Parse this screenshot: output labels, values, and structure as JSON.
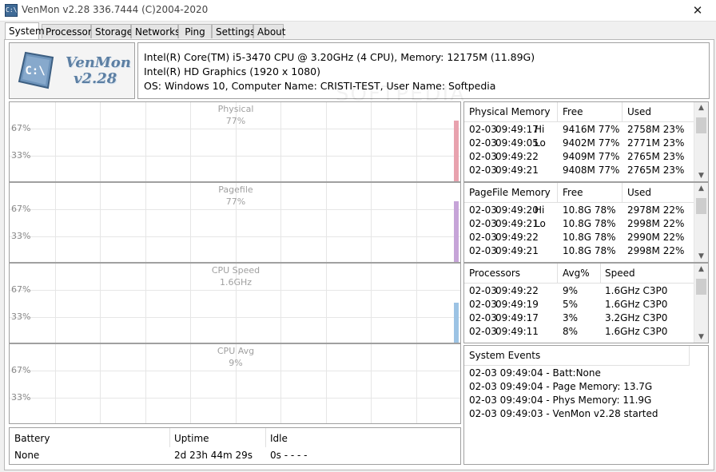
{
  "window": {
    "title": "VenMon v2.28 336.7444 (C)2004-2020",
    "close_symbol": "✕"
  },
  "tabs": [
    {
      "label": "System",
      "active": true
    },
    {
      "label": "Processors"
    },
    {
      "label": "Storage"
    },
    {
      "label": "Networks"
    },
    {
      "label": "Ping"
    },
    {
      "label": "Settings"
    },
    {
      "label": "About"
    }
  ],
  "logo": {
    "glyph": "C:\\",
    "name": "VenMon",
    "version": "v2.28"
  },
  "sysinfo": {
    "line1": "Intel(R) Core(TM) i5-3470 CPU @ 3.20GHz (4 CPU), Memory: 12175M (11.89G)",
    "line2": "Intel(R) HD Graphics (1920 x 1080)",
    "line3": "OS: Windows 10, Computer Name: CRISTI-TEST, User Name: Softpedia"
  },
  "graphs": [
    {
      "title": "Physical",
      "value": "77%",
      "tick_high": "67%",
      "tick_low": "33%",
      "level": 0.77,
      "color": "#e8a2ae"
    },
    {
      "title": "Pagefile",
      "value": "77%",
      "tick_high": "67%",
      "tick_low": "33%",
      "level": 0.77,
      "color": "#c6a4d8"
    },
    {
      "title": "CPU Speed",
      "value": "1.6GHz",
      "tick_high": "67%",
      "tick_low": "33%",
      "level": 0.5,
      "color": "#9cc3e4"
    },
    {
      "title": "CPU Avg",
      "value": "9%",
      "tick_high": "67%",
      "tick_low": "33%",
      "level": 0.0,
      "color": "#9ad2a6"
    }
  ],
  "physical_memory": {
    "headers": [
      "Physical Memory",
      "Free",
      "Used"
    ],
    "rows": [
      {
        "date": "02-03",
        "time": "09:49:17",
        "tag": "Hi",
        "free": "9416M 77%",
        "used": "2758M 23%"
      },
      {
        "date": "02-03",
        "time": "09:49:05",
        "tag": "Lo",
        "free": "9402M 77%",
        "used": "2771M 23%"
      },
      {
        "date": "02-03",
        "time": "09:49:22",
        "tag": "",
        "free": "9409M 77%",
        "used": "2765M 23%"
      },
      {
        "date": "02-03",
        "time": "09:49:21",
        "tag": "",
        "free": "9408M 77%",
        "used": "2765M 23%"
      }
    ]
  },
  "pagefile_memory": {
    "headers": [
      "PageFile Memory",
      "Free",
      "Used"
    ],
    "rows": [
      {
        "date": "02-03",
        "time": "09:49:20",
        "tag": "Hi",
        "free": "10.8G 78%",
        "used": "2978M 22%"
      },
      {
        "date": "02-03",
        "time": "09:49:21",
        "tag": "Lo",
        "free": "10.8G 78%",
        "used": "2998M 22%"
      },
      {
        "date": "02-03",
        "time": "09:49:22",
        "tag": "",
        "free": "10.8G 78%",
        "used": "2990M 22%"
      },
      {
        "date": "02-03",
        "time": "09:49:21",
        "tag": "",
        "free": "10.8G 78%",
        "used": "2998M 22%"
      }
    ]
  },
  "processors": {
    "headers": [
      "Processors",
      "Avg%",
      "Speed"
    ],
    "rows": [
      {
        "date": "02-03",
        "time": "09:49:22",
        "tag": "",
        "free": "9%",
        "used": "1.6GHz C3P0"
      },
      {
        "date": "02-03",
        "time": "09:49:19",
        "tag": "",
        "free": "5%",
        "used": "1.6GHz C3P0"
      },
      {
        "date": "02-03",
        "time": "09:49:17",
        "tag": "",
        "free": "3%",
        "used": "3.2GHz C3P0"
      },
      {
        "date": "02-03",
        "time": "09:49:11",
        "tag": "",
        "free": "8%",
        "used": "1.6GHz C3P0"
      }
    ]
  },
  "system_events": {
    "header": "System Events",
    "rows": [
      "02-03  09:49:04 - Batt:None",
      "02-03  09:49:04 - Page Memory: 13.7G",
      "02-03  09:49:04 - Phys Memory: 11.9G",
      "02-03  09:49:03 - VenMon v2.28 started"
    ]
  },
  "status": {
    "battery_label": "Battery",
    "battery_value": "None",
    "uptime_label": "Uptime",
    "uptime_value": "2d 23h 44m 29s",
    "idle_label": "Idle",
    "idle_value": "0s  - - - -"
  },
  "watermark": "SOFTPEDIA"
}
